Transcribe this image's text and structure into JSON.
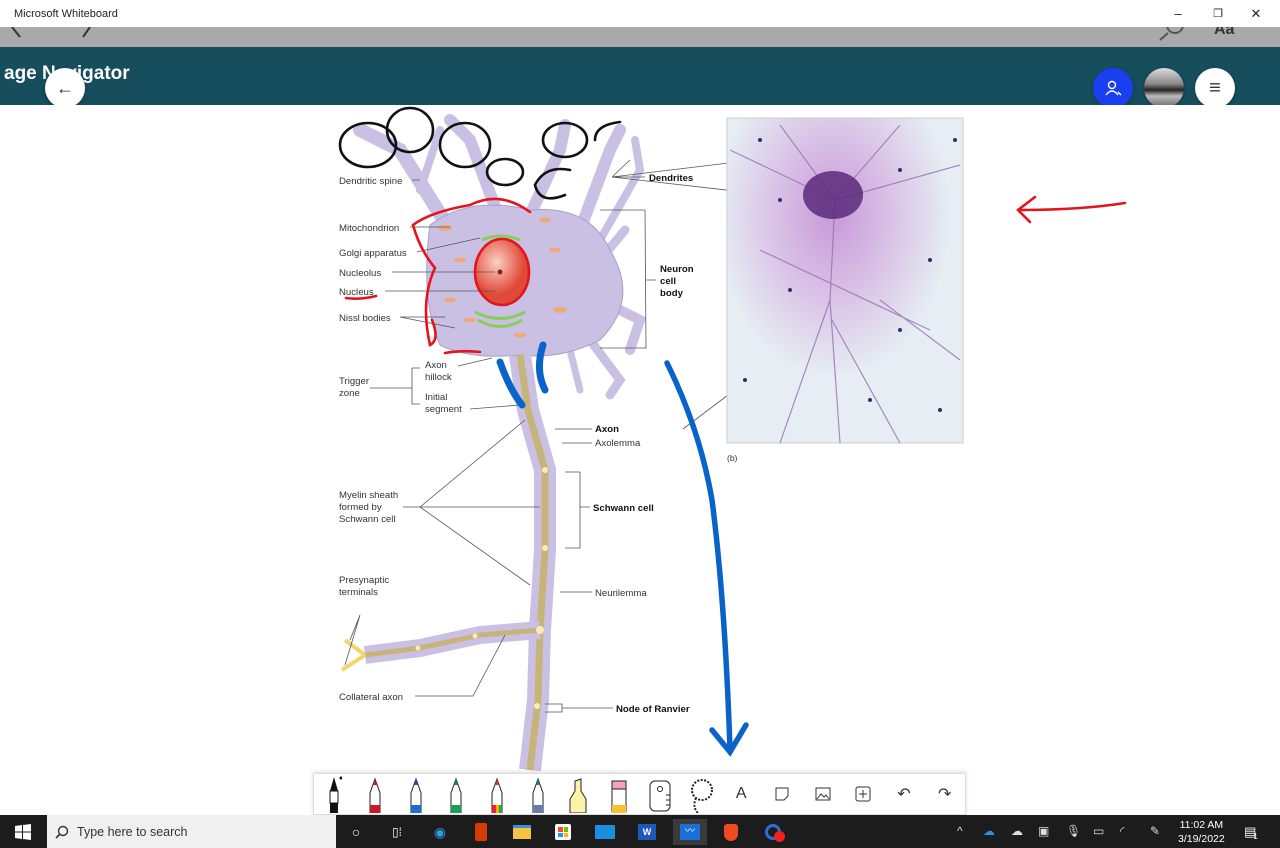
{
  "window": {
    "title": "Microsoft Whiteboard",
    "minimize": "–",
    "restore": "❐",
    "close": "✕"
  },
  "header": {
    "page_title": "age Navigator",
    "back_icon": "←",
    "menu_icon": "≡",
    "share_icon": "person-add-icon",
    "top_strip_icons": [
      "search-icon",
      "Aa"
    ]
  },
  "diagram": {
    "labels": {
      "dendritic_spine": "Dendritic spine",
      "mitochondrion": "Mitochondrion",
      "golgi": "Golgi apparatus",
      "nucleolus": "Nucleolus",
      "nucleus": "Nucleus",
      "nissl": "Nissl bodies",
      "trigger_zone": [
        "Trigger",
        "zone"
      ],
      "axon_hillock": [
        "Axon",
        "hillock"
      ],
      "initial_segment": [
        "Initial",
        "segment"
      ],
      "dendrites": "Dendrites",
      "cell_body": [
        "Neuron",
        "cell",
        "body"
      ],
      "axon": "Axon",
      "axolemma": "Axolemma",
      "myelin": [
        "Myelin sheath",
        "formed by",
        "Schwann cell"
      ],
      "schwann": "Schwann cell",
      "presynaptic": [
        "Presynaptic",
        "terminals"
      ],
      "neurilemma": "Neurilemma",
      "collateral": "Collateral axon",
      "node": "Node of Ranvier",
      "panel_b": "(b)"
    }
  },
  "ink_colors": {
    "black": "#111111",
    "red": "#e3141c",
    "blue": "#0a63c9"
  },
  "toolbar": {
    "tools": [
      "black-pen",
      "red-pen",
      "blue-pen",
      "green-pen",
      "rainbow-pen",
      "galaxy-pen",
      "highlighter",
      "eraser",
      "ruler",
      "lasso",
      "text",
      "sticky-note",
      "image",
      "insert",
      "undo",
      "redo"
    ],
    "text_label": "A",
    "undo": "↶",
    "redo": "↷",
    "insert": "+"
  },
  "taskbar": {
    "search_placeholder": "Type here to search",
    "time": "11:02 AM",
    "date": "3/19/2022",
    "notifications": "1",
    "apps": [
      "cortana",
      "task-view",
      "edge",
      "office",
      "file-explorer",
      "store",
      "mail",
      "word",
      "whiteboard",
      "brave",
      "recorder"
    ]
  }
}
